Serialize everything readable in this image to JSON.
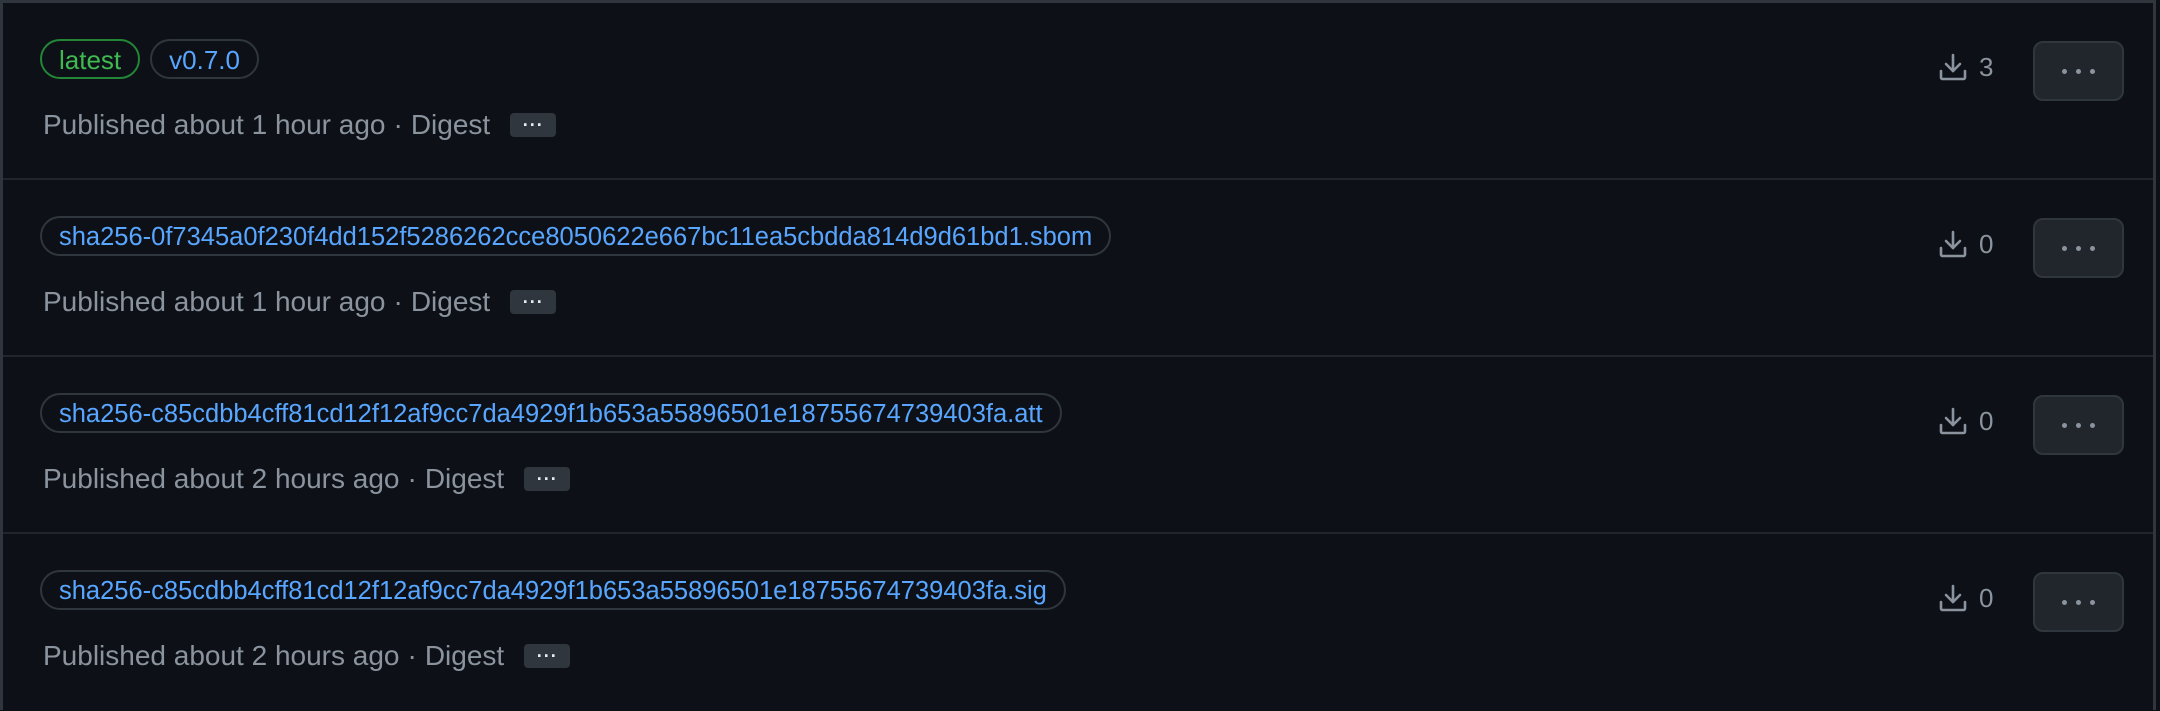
{
  "versions": [
    {
      "tags": [
        {
          "label": "latest",
          "kind": "latest"
        },
        {
          "label": "v0.7.0",
          "kind": "version"
        }
      ],
      "published": "Published about 1 hour ago",
      "separator": "·",
      "digest_label": "Digest",
      "digest_toggle": "···",
      "downloads": "3"
    },
    {
      "tags": [
        {
          "label": "sha256-0f7345a0f230f4dd152f5286262cce8050622e667bc11ea5cbdda814d9d61bd1.sbom",
          "kind": "digest"
        }
      ],
      "published": "Published about 1 hour ago",
      "separator": "·",
      "digest_label": "Digest",
      "digest_toggle": "···",
      "downloads": "0"
    },
    {
      "tags": [
        {
          "label": "sha256-c85cdbb4cff81cd12f12af9cc7da4929f1b653a55896501e18755674739403fa.att",
          "kind": "digest"
        }
      ],
      "published": "Published about 2 hours ago",
      "separator": "·",
      "digest_label": "Digest",
      "digest_toggle": "···",
      "downloads": "0"
    },
    {
      "tags": [
        {
          "label": "sha256-c85cdbb4cff81cd12f12af9cc7da4929f1b653a55896501e18755674739403fa.sig",
          "kind": "digest"
        }
      ],
      "published": "Published about 2 hours ago",
      "separator": "·",
      "digest_label": "Digest",
      "digest_toggle": "···",
      "downloads": "0"
    }
  ],
  "icons": {
    "download": "download-icon",
    "menu": "kebab-horizontal-icon"
  },
  "colors": {
    "background": "#0d1117",
    "border": "#30363d",
    "latest_tag": "#3fb950",
    "link": "#58a6ff",
    "muted_text": "#8b949e"
  }
}
